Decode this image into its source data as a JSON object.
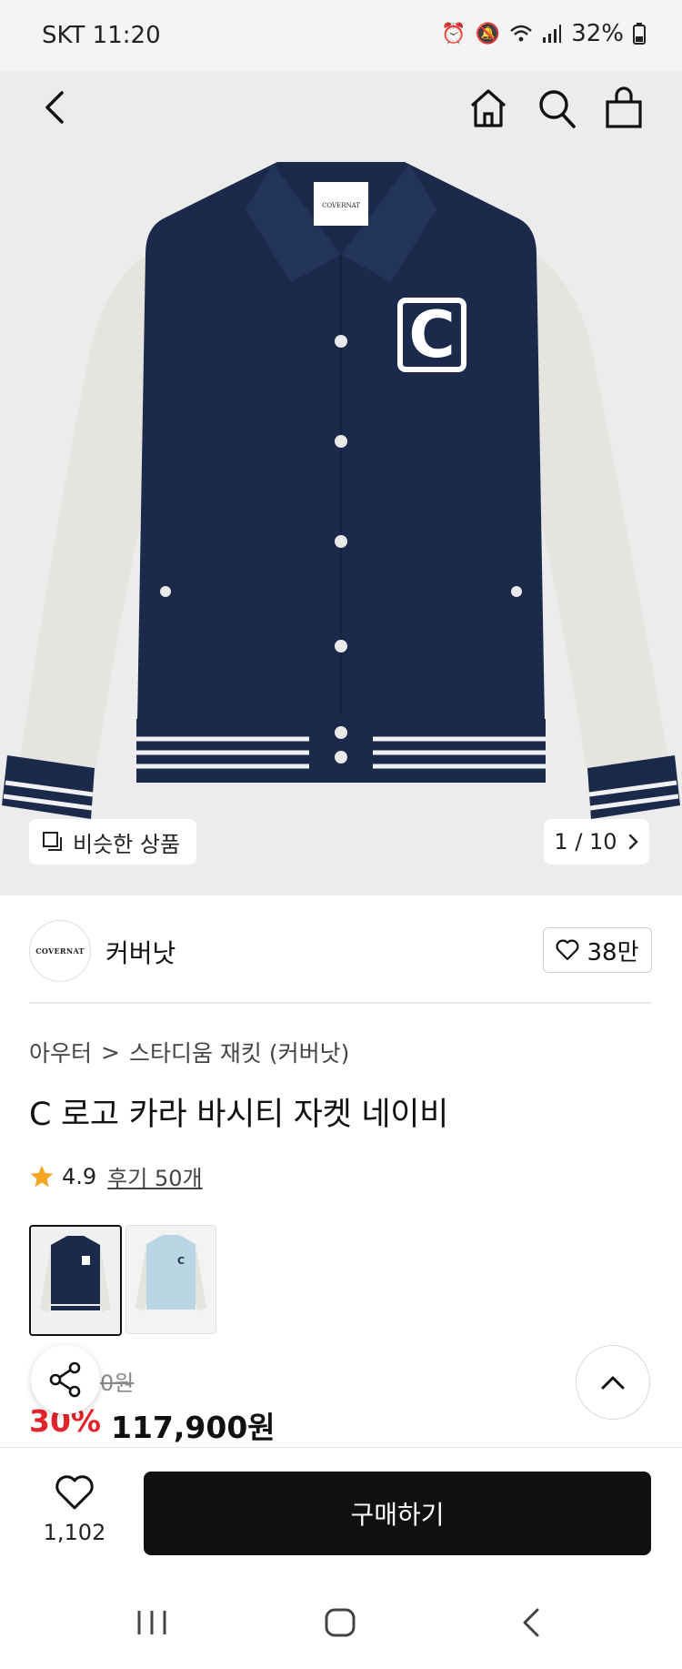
{
  "status_bar": {
    "time": "SKT 11:20",
    "battery": "32%",
    "icons": [
      "alarm-icon",
      "mute-icon",
      "wifi-icon",
      "signal-icon",
      "battery-icon"
    ]
  },
  "top_bar": {
    "icons": [
      "back-icon",
      "home-icon",
      "search-icon",
      "shopping-bag-icon"
    ]
  },
  "gallery": {
    "similar_label": "비슷한 상품",
    "page_indicator": "1 / 10",
    "jacket_label_text": "COVERNAT",
    "jacket_letter": "C"
  },
  "brand": {
    "logo_text": "COVERNAT",
    "name": "커버낫",
    "like_count": "38만"
  },
  "breadcrumb": {
    "category": "아우터",
    "separator": ">",
    "subcategory": "스타디움 재킷 (커버낫)"
  },
  "product": {
    "title": "C 로고 카라 바시티 자켓 네이비",
    "rating": "4.9",
    "review_link": "후기 50개",
    "thumbnails": [
      "navy",
      "light-blue"
    ],
    "original_price_fragment": "0원",
    "discount_rate": "30%",
    "final_price": "117,900원"
  },
  "action_bar": {
    "wish_count": "1,102",
    "buy_label": "구매하기"
  },
  "colors": {
    "accent_red": "#e3242b",
    "navy": "#1b2a4a",
    "buy_button": "#111111"
  }
}
